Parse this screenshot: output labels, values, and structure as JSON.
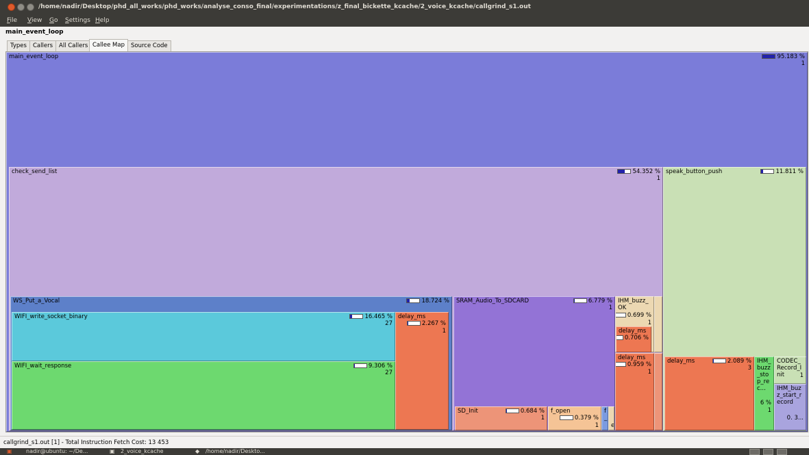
{
  "window": {
    "title": "/home/nadir/Desktop/phd_all_works/phd_works/analyse_conso_final/experimentations/z_final_bickette_kcache/2_voice_kcache/callgrind_s1.out"
  },
  "menu": {
    "items": [
      "File",
      "View",
      "Go",
      "Settings",
      "Help"
    ]
  },
  "location": "main_event_loop",
  "tabs": [
    "Types",
    "Callers",
    "All Callers",
    "Callee Map",
    "Source Code"
  ],
  "active_tab": "Callee Map",
  "treemap": {
    "blocks": [
      {
        "id": "main_event_loop",
        "label": "main_event_loop",
        "pct": "95.183 %",
        "count": "1",
        "fill": 0.95,
        "color": "#7b7cd9"
      },
      {
        "id": "check_send_list",
        "label": "check_send_list",
        "pct": "54.352 %",
        "count": "1",
        "fill": 0.54,
        "color": "#c1aadb"
      },
      {
        "id": "speak_button_push",
        "label": "speak_button_push",
        "pct": "11.811 %",
        "count": "",
        "fill": 0.12,
        "color": "#c9e0b5"
      },
      {
        "id": "ws_put_a_vocal",
        "label": "WS_Put_a_Vocal",
        "pct": "18.724 %",
        "count": "",
        "fill": 0.19,
        "color": "#5d80c9"
      },
      {
        "id": "wifi_write_socket_binary",
        "label": "WIFI_write_socket_binary",
        "pct": "16.465 %",
        "count": "27",
        "fill": 0.16,
        "color": "#5bc9db"
      },
      {
        "id": "wifi_wait_response",
        "label": "WIFI_wait_response",
        "pct": "9.306 %",
        "count": "27",
        "fill": 0.09,
        "color": "#6dd96f"
      },
      {
        "id": "delay_ms_1",
        "label": "delay_ms",
        "pct": "2.267 %",
        "count": "1",
        "fill": 0.02,
        "color": "#ed7752"
      },
      {
        "id": "sram_audio_to_sdcard",
        "label": "SRAM_Audio_To_SDCARD",
        "pct": "6.779 %",
        "count": "1",
        "fill": 0.07,
        "color": "#9373d6"
      },
      {
        "id": "sd_init",
        "label": "SD_Init",
        "pct": "0.684 %",
        "count": "1",
        "fill": 0.01,
        "color": "#ed9478"
      },
      {
        "id": "f_open",
        "label": "f_open",
        "pct": "0.379 %",
        "count": "1",
        "fill": 0.0,
        "color": "#f5c496"
      },
      {
        "id": "ihm_buzz_ok",
        "label": "IHM_buzz_OK",
        "pct": "0.699 %",
        "count": "1",
        "fill": 0.01,
        "color": "#ecd8b2"
      },
      {
        "id": "delay_ms_2",
        "label": "delay_ms",
        "pct": "0.706 %",
        "count": "",
        "fill": 0.01,
        "color": "#ed7752"
      },
      {
        "id": "delay_ms_3",
        "label": "delay_ms",
        "pct": "0.959 %",
        "count": "1",
        "fill": 0.01,
        "color": "#ed7752"
      },
      {
        "id": "delay_ms_4",
        "label": "delay_ms",
        "pct": "2.089 %",
        "count": "3",
        "fill": 0.02,
        "color": "#ed7752"
      },
      {
        "id": "ihm_buzz_stop_rec",
        "label": "IHM_buzz_stop_rec...",
        "pct": "6 %",
        "count": "1",
        "fill": 0.0,
        "color": "#6dd96f"
      },
      {
        "id": "codec_record_init",
        "label": "CODEC_Record_Init",
        "pct": "",
        "count": "1",
        "fill": 0.0,
        "color": "#c9e0b5"
      },
      {
        "id": "ihm_buzz_start_record",
        "label": "IHM_buzz_start_record",
        "pct": "0. 3...",
        "count": "",
        "fill": 0.0,
        "color": "#a9a4de"
      }
    ],
    "small_marks": [
      "f_",
      "e"
    ]
  },
  "status": "callgrind_s1.out [1] - Total Instruction Fetch Cost: 13 453",
  "taskbar": {
    "items": [
      "nadir@ubuntu: ~/De...",
      "2_voice_kcache",
      "/home/nadir/Deskto..."
    ]
  }
}
